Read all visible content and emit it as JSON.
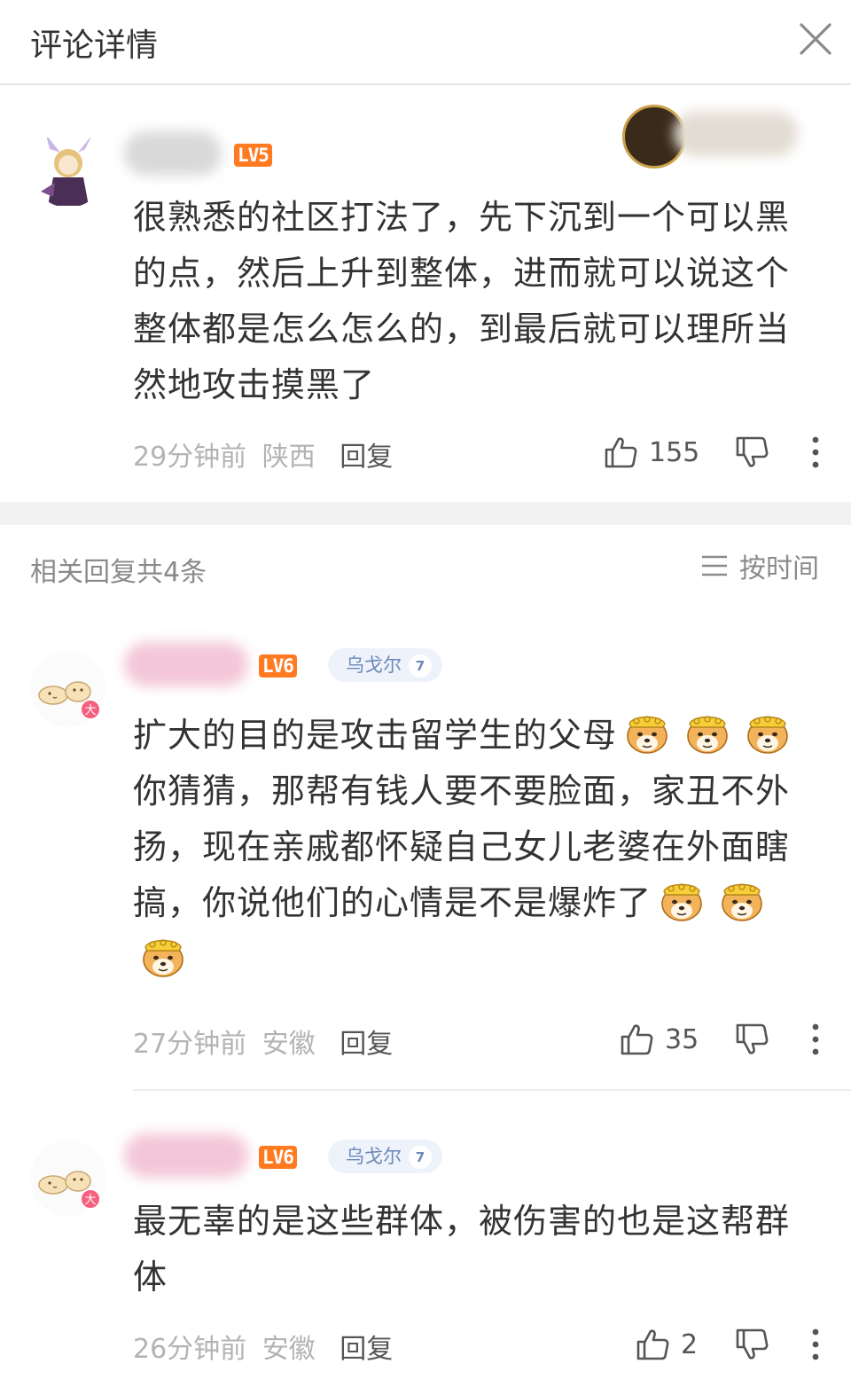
{
  "header": {
    "title": "评论详情"
  },
  "main_comment": {
    "level": "LV5",
    "text": "很熟悉的社区打法了，先下沉到一个可以黑的点，然后上升到整体，进而就可以说这个整体都是怎么怎么的，到最后就可以理所当然地攻击摸黑了",
    "time": "29分钟前",
    "location": "陕西",
    "reply_label": "回复",
    "likes": "155"
  },
  "replies_header": {
    "count_label": "相关回复共4条",
    "sort_label": "按时间"
  },
  "replies": [
    {
      "level": "LV6",
      "fan_name": "乌戈尔",
      "fan_level": "7",
      "badge": "大",
      "text_1": "扩大的目的是攻击留学生的父母",
      "text_2": "你猜猜，那帮有钱人要不要脸面，家丑不外扬，现在亲戚都怀疑自己女儿老婆在外面瞎搞，你说他们的心情是不是爆炸了",
      "time": "27分钟前",
      "location": "安徽",
      "reply_label": "回复",
      "likes": "35"
    },
    {
      "level": "LV6",
      "fan_name": "乌戈尔",
      "fan_level": "7",
      "badge": "大",
      "text": "最无辜的是这些群体，被伤害的也是这帮群体",
      "time": "26分钟前",
      "location": "安徽",
      "reply_label": "回复",
      "likes": "2"
    }
  ],
  "icons": {
    "close": "close-icon",
    "like": "thumb-up-icon",
    "dislike": "thumb-down-icon",
    "more": "more-vertical-icon",
    "sort": "list-icon",
    "emoji": "doge-emoji-icon"
  },
  "colors": {
    "level_badge": "#ff7a21",
    "fan_tag_bg": "#eef3fb",
    "fan_tag_text": "#6b88b8",
    "big_badge": "#f5607d",
    "meta_text": "#b3b3b3"
  }
}
